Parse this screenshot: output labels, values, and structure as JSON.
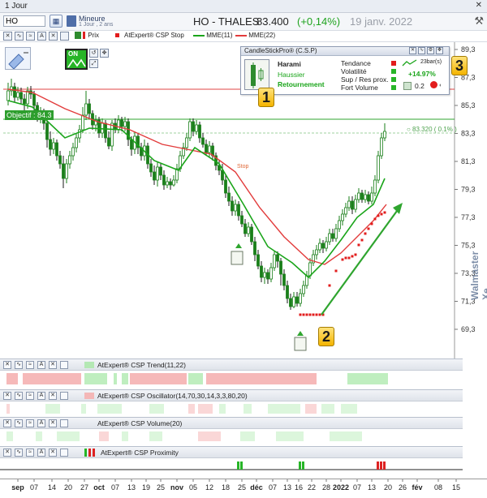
{
  "window": {
    "title": "1 Jour",
    "pin_glyph": "✕"
  },
  "toolbar": {
    "symbol_value": "HO",
    "period_main": "Mineure",
    "period_sub": "1 Jour , 2 ans",
    "instrument_name": "HO - THALES",
    "price": "83.400",
    "change": "(+0,14%)",
    "date": "19 janv. 2022",
    "tools_glyph": "⚒"
  },
  "legend": {
    "prix": "Prix",
    "csp_stop": "AtExpert® CSP Stop",
    "mme11": "MME(11)",
    "mme22": "MME(22)",
    "colors": {
      "mme11": "#1aa51a",
      "mme22": "#e23b3b",
      "stop": "#e21c1c"
    }
  },
  "chart": {
    "objective_label": "Objectif : 84.3",
    "last_price_label": "○ 83.320 ( 0.1% )",
    "stop_label": "Stop",
    "on_label": "ON",
    "watermark": "Walmaster Xe",
    "y_labels": [
      "89,3",
      "87,3",
      "85,3",
      "83,3",
      "81,3",
      "79,3",
      "77,3",
      "75,3",
      "73,3",
      "71,3",
      "69,3"
    ],
    "x_labels": [
      "sep",
      "07",
      "14",
      "20",
      "27",
      "oct",
      "07",
      "13",
      "19",
      "25",
      "nov",
      "05",
      "12",
      "18",
      "25",
      "déc",
      "07",
      "13",
      "16",
      "22",
      "28",
      "2022",
      "07",
      "13",
      "20",
      "26",
      "fév",
      "08",
      "15"
    ]
  },
  "csp_popup": {
    "title": "CandleStickPro® (C.S.P)",
    "pattern": "Harami",
    "direction": "Haussier",
    "type": "Retournement",
    "rows": [
      "Tendance",
      "Volatilité",
      "Sup / Res prox.",
      "Fort Volume"
    ],
    "bars_label": "23bar(s)",
    "perf": "+14.97%",
    "ratio": "0.2"
  },
  "badges": {
    "b1": "1",
    "b2": "2",
    "b3": "3"
  },
  "panels": [
    {
      "label": "AtExpert® CSP Trend(11,22)"
    },
    {
      "label": "AtExpert® CSP Oscillator(14,70,30,14,3,3,80,20)"
    },
    {
      "label": "AtExpert® CSP Volume(20)"
    },
    {
      "label": "AtExpert® CSP Proximity"
    }
  ]
}
